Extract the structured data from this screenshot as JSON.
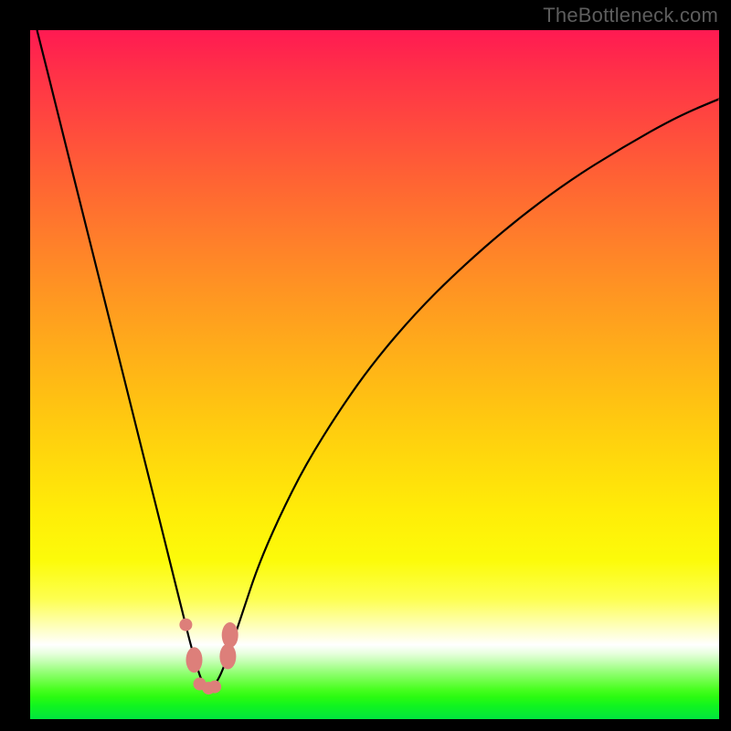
{
  "watermark": "TheBottleneck.com",
  "colors": {
    "frame": "#000000",
    "curve": "#000000",
    "marker_fill": "#dd7f7a",
    "marker_stroke": "#c96c67"
  },
  "chart_data": {
    "type": "line",
    "title": "",
    "xlabel": "",
    "ylabel": "",
    "xlim": [
      0,
      100
    ],
    "ylim": [
      0,
      100
    ],
    "grid": false,
    "series": [
      {
        "name": "bottleneck-curve",
        "x": [
          1,
          4,
          8,
          12,
          15,
          18,
          20,
          22,
          23.5,
          24.7,
          25.5,
          26.3,
          27.5,
          29,
          31,
          33,
          36,
          40,
          45,
          50,
          56,
          62,
          70,
          78,
          86,
          94,
          100
        ],
        "values": [
          100,
          88,
          72,
          56,
          44,
          32,
          24,
          16,
          10,
          6,
          4.4,
          4.4,
          6,
          10,
          16,
          22,
          29,
          37,
          45,
          52,
          59,
          65,
          72,
          78,
          83,
          87.5,
          90
        ]
      }
    ],
    "markers": [
      {
        "x": 22.6,
        "y": 13.7,
        "size": "small"
      },
      {
        "x": 23.8,
        "y": 8.6,
        "size": "large"
      },
      {
        "x": 24.6,
        "y": 5.1,
        "size": "small"
      },
      {
        "x": 25.9,
        "y": 4.5,
        "size": "small"
      },
      {
        "x": 26.8,
        "y": 4.7,
        "size": "small"
      },
      {
        "x": 28.7,
        "y": 9.1,
        "size": "large"
      },
      {
        "x": 29.0,
        "y": 12.2,
        "size": "large"
      }
    ]
  }
}
